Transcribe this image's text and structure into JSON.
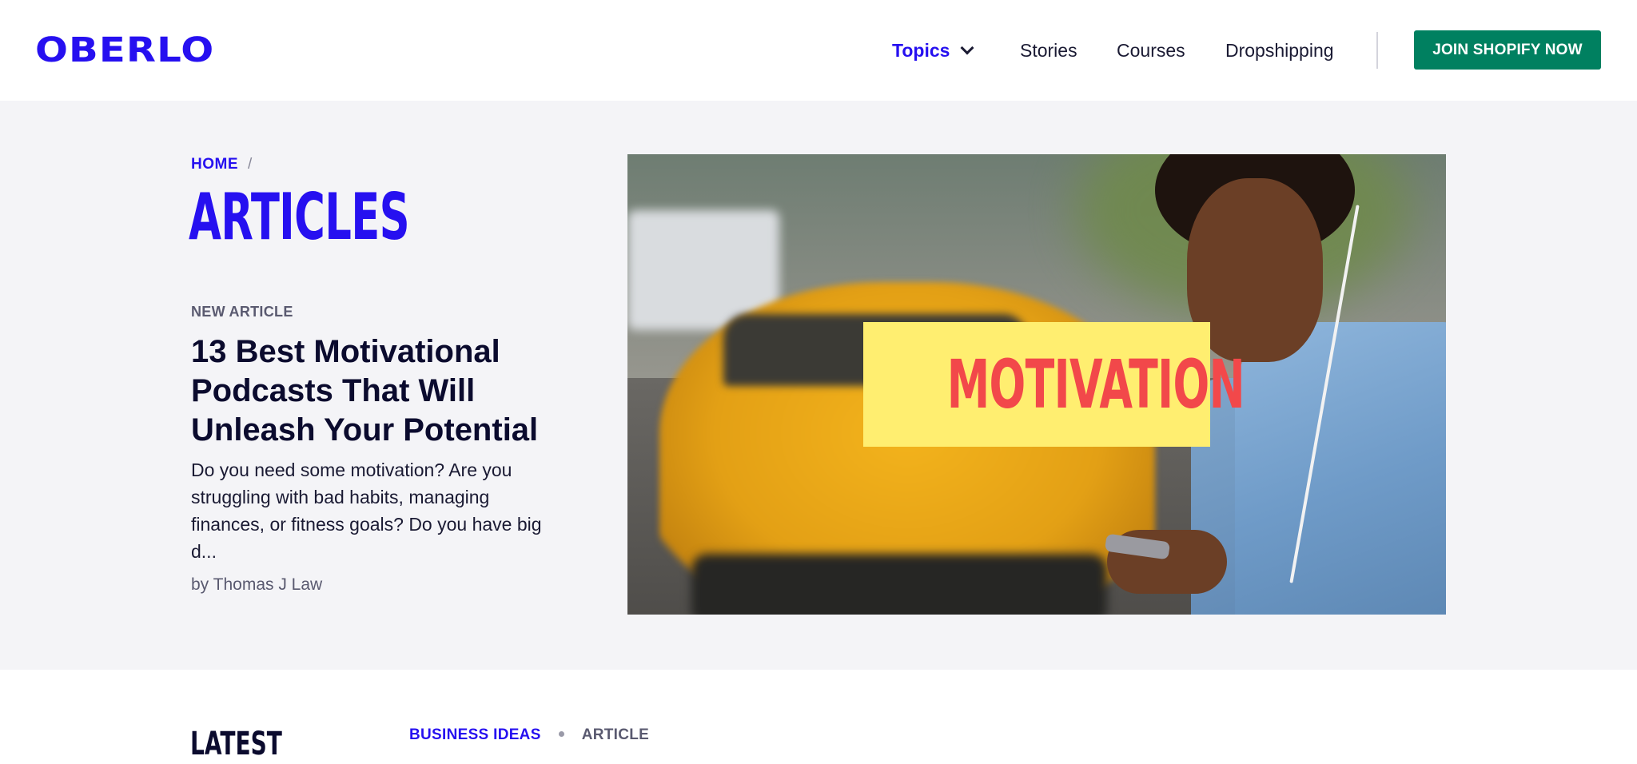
{
  "header": {
    "logo": "OBERLO",
    "nav": {
      "topics": "Topics",
      "stories": "Stories",
      "courses": "Courses",
      "dropshipping": "Dropshipping"
    },
    "cta": "JOIN SHOPIFY NOW"
  },
  "hero": {
    "breadcrumb": {
      "home": "HOME",
      "separator": "/"
    },
    "page_title": "ARTICLES",
    "eyebrow": "NEW ARTICLE",
    "article_title": "13 Best Motivational Podcasts That Will Unleash Your Potential",
    "excerpt": "Do you need some motivation? Are you struggling with bad habits, managing finances, or fitness goals? Do you have big d...",
    "byline": "by Thomas J Law",
    "image_overlay_text": "MOTIVATION"
  },
  "latest": {
    "heading": "LATEST",
    "category": "BUSINESS IDEAS",
    "type": "ARTICLE"
  },
  "icons": {
    "topics_dropdown": "chevron-down-icon"
  },
  "colors": {
    "brand": "#2610f0",
    "cta": "#008060",
    "hero_bg": "#f4f4f7",
    "overlay_box": "#ffee70",
    "overlay_text": "#f2484a"
  }
}
